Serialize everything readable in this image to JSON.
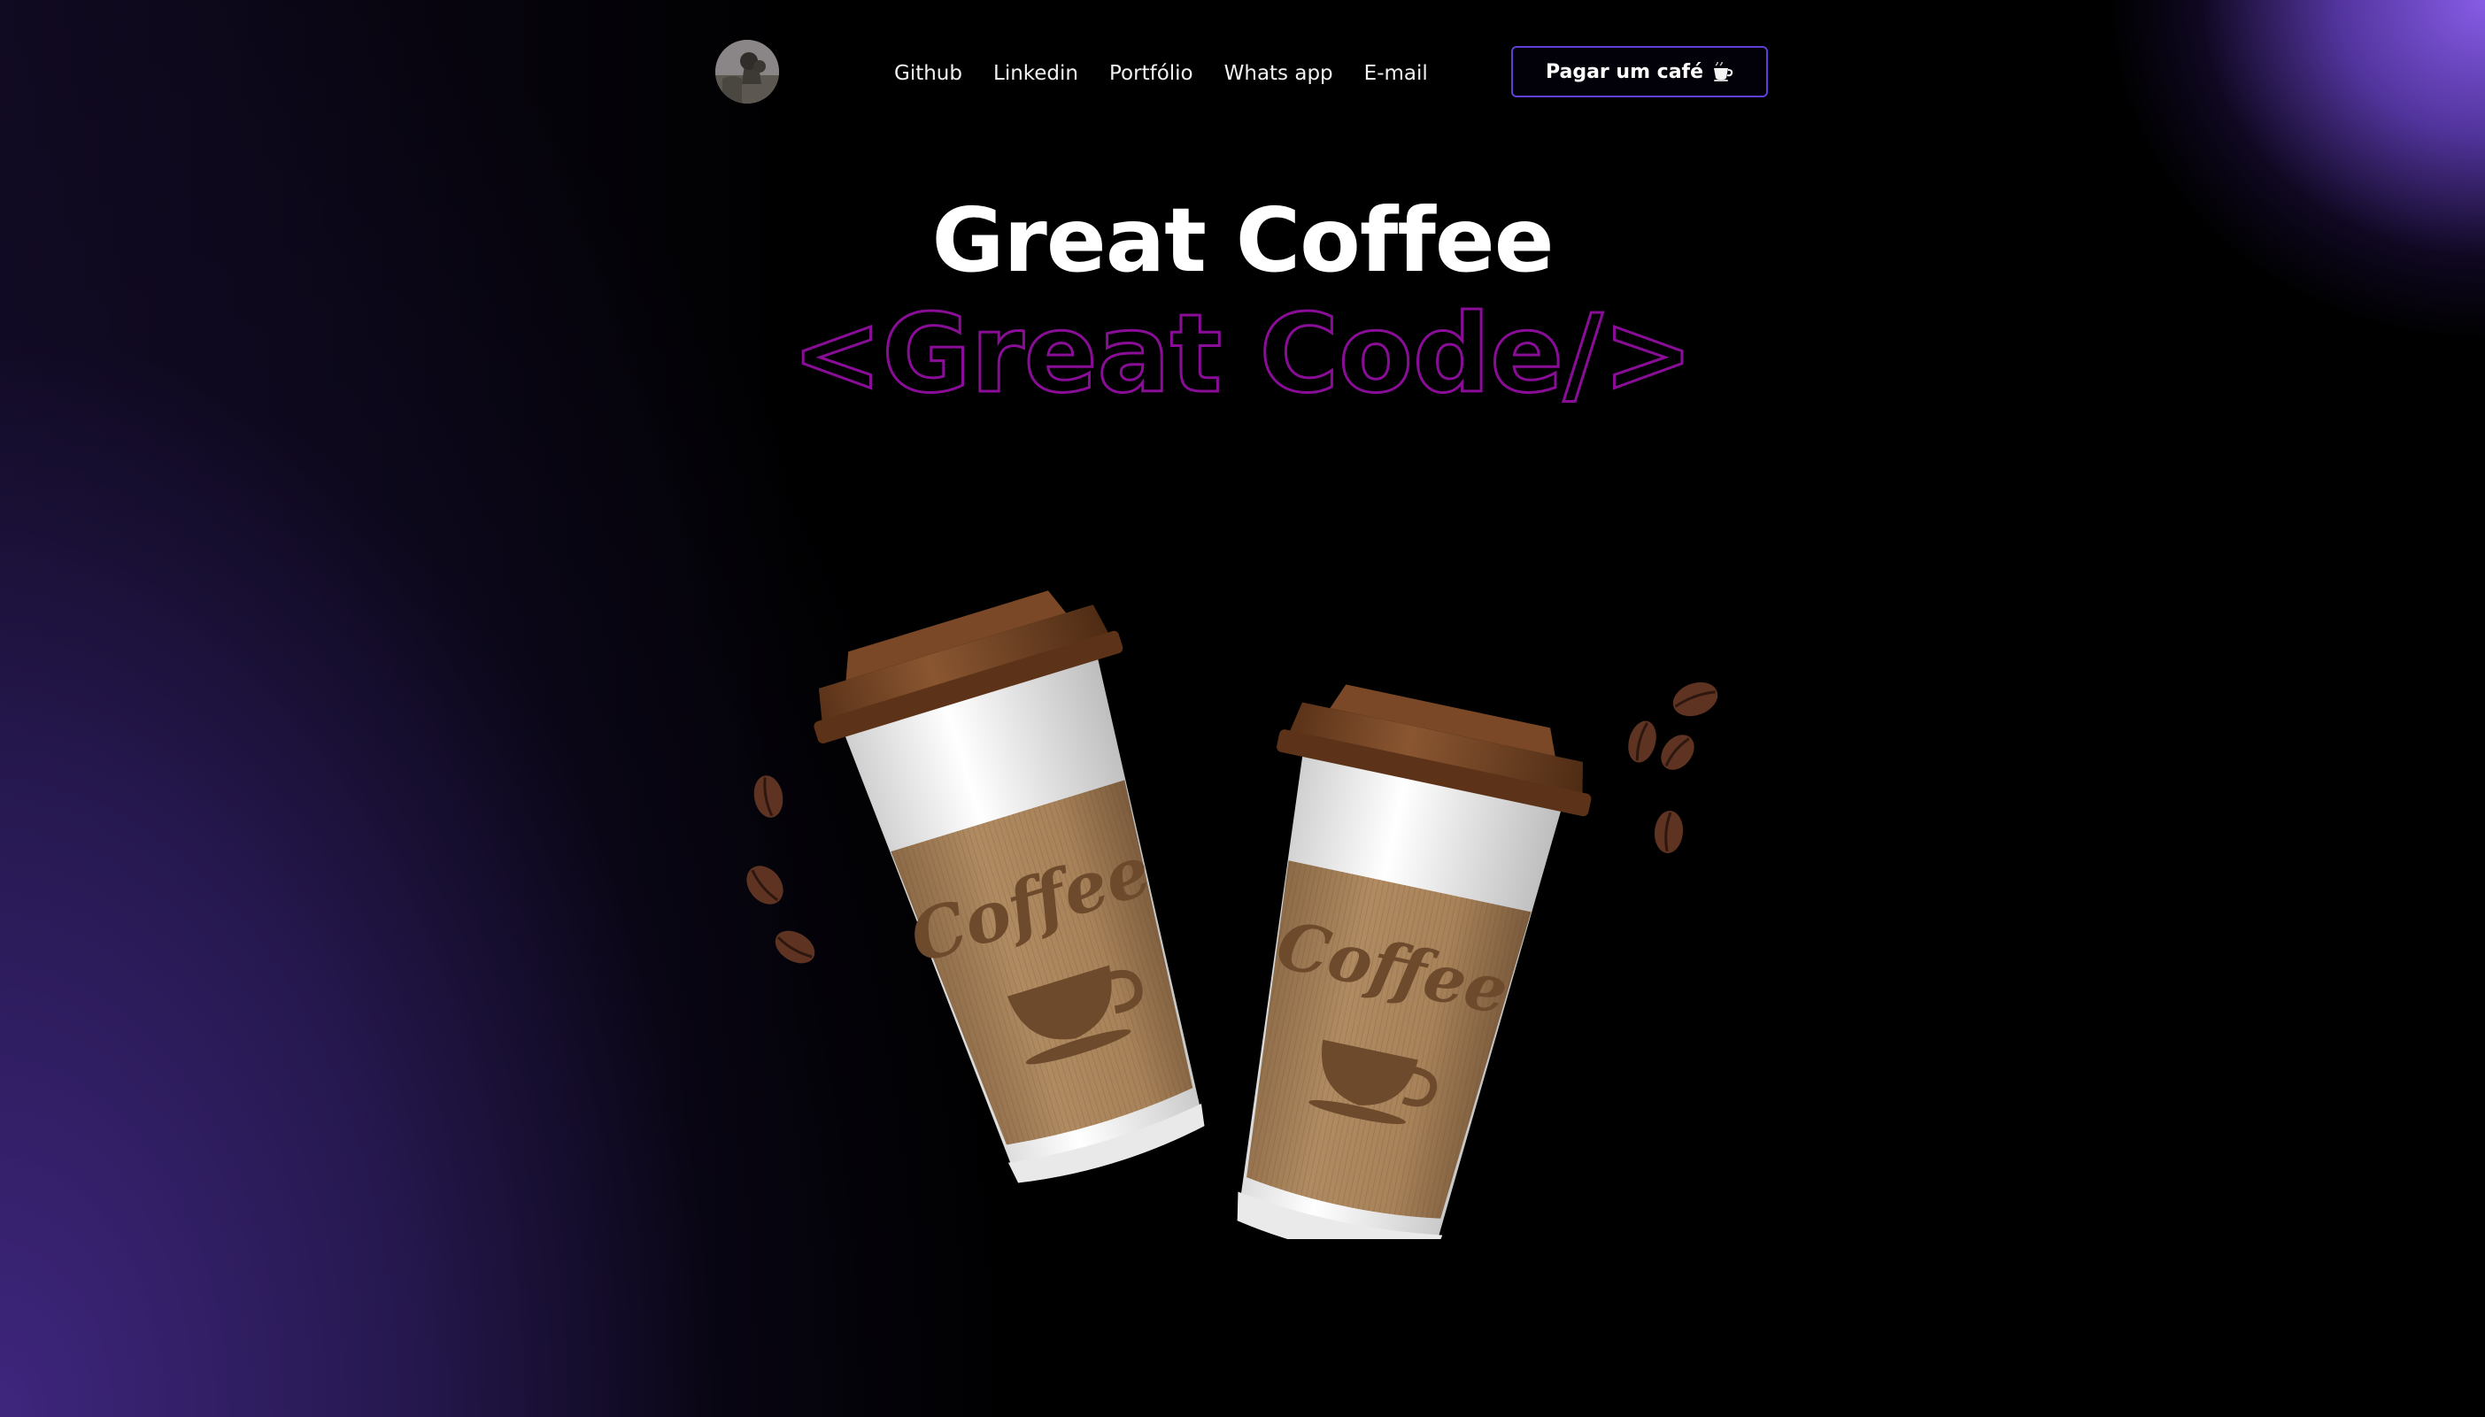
{
  "header": {
    "nav": [
      "Github",
      "Linkedin",
      "Portfólio",
      "Whats app",
      "E-mail"
    ],
    "cta_label": "Pagar um café"
  },
  "hero": {
    "title": "Great Coffee",
    "subtitle": "<Great Code/>",
    "cup_label": "Coffee"
  },
  "colors": {
    "accent_purple": "#5f3fd8",
    "outline_magenta": "#8a0d98",
    "sleeve": "#a8845e",
    "lid": "#6b3f21"
  },
  "icons": [
    "avatar",
    "coffee-cup-icon",
    "coffee-bean-icon"
  ]
}
